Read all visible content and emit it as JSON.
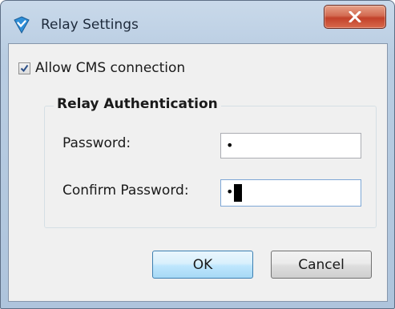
{
  "window": {
    "title": "Relay Settings",
    "close_glyph": "x",
    "icon": "shield-check-icon"
  },
  "cms": {
    "label": "Allow CMS connection",
    "checked": true
  },
  "relay_auth": {
    "title": "Relay Authentication",
    "password_label": "Password:",
    "password_value": "•",
    "confirm_label": "Confirm Password:",
    "confirm_value": "•"
  },
  "buttons": {
    "ok": "OK",
    "cancel": "Cancel"
  },
  "colors": {
    "close_button": "#c2412a",
    "ok_button_border": "#3c7fb1",
    "titlebar": "#b9cde2"
  }
}
